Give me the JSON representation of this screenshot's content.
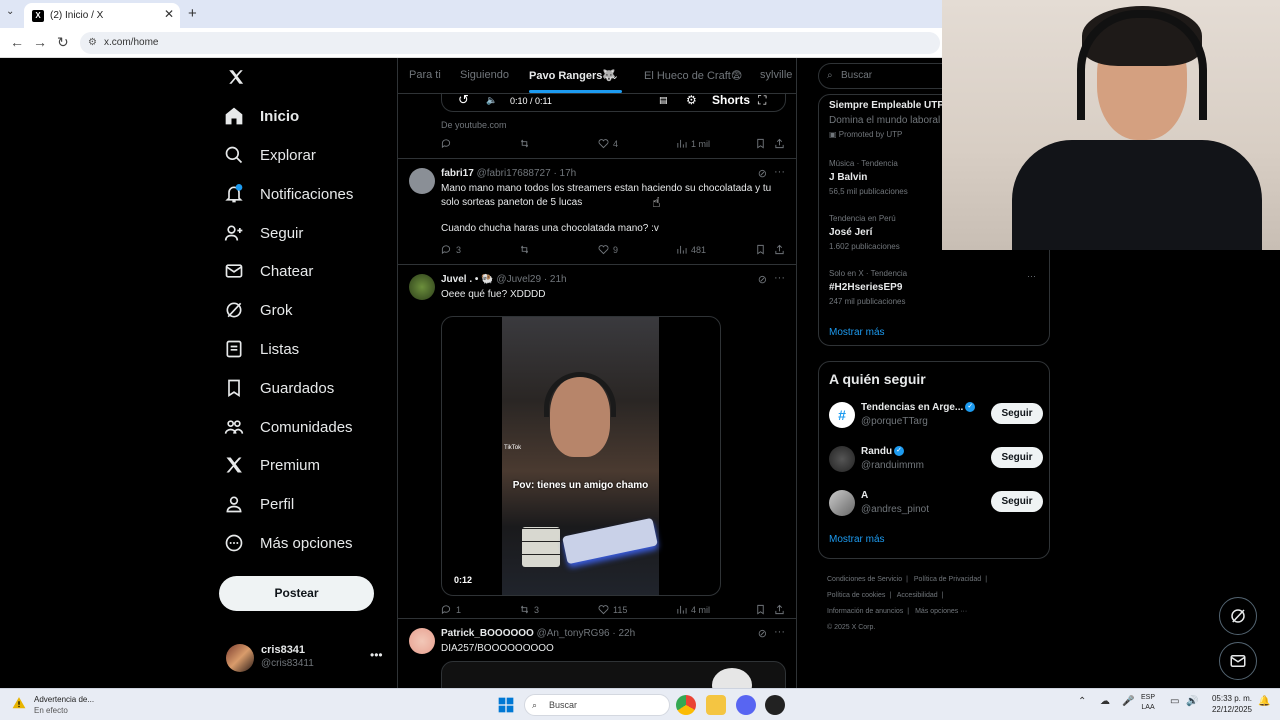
{
  "browser": {
    "tab_title": "(2) Inicio / X",
    "url": "x.com/home"
  },
  "nav": {
    "items": [
      {
        "label": "Inicio",
        "icon": "home-icon"
      },
      {
        "label": "Explorar",
        "icon": "search-icon"
      },
      {
        "label": "Notificaciones",
        "icon": "bell-icon",
        "badge": "2"
      },
      {
        "label": "Seguir",
        "icon": "follow-icon"
      },
      {
        "label": "Chatear",
        "icon": "mail-icon"
      },
      {
        "label": "Grok",
        "icon": "grok-icon"
      },
      {
        "label": "Listas",
        "icon": "list-icon"
      },
      {
        "label": "Guardados",
        "icon": "bookmark-icon"
      },
      {
        "label": "Comunidades",
        "icon": "communities-icon"
      },
      {
        "label": "Premium",
        "icon": "x-logo-icon"
      },
      {
        "label": "Perfil",
        "icon": "profile-icon"
      },
      {
        "label": "Más opciones",
        "icon": "more-icon"
      }
    ],
    "post_label": "Postear",
    "account_name": "cris8341",
    "account_handle": "@cris83411"
  },
  "topbar": {
    "tabs": [
      "Para ti",
      "Siguiendo",
      "Pavo Rangers🐺",
      "El Hueco de Craft😨",
      "sylville"
    ]
  },
  "tweets": {
    "t0": {
      "time": "0:10 / 0:11",
      "shorts": "Shorts",
      "source": "De youtube.com",
      "replies": "",
      "retweets": "",
      "likes": "4",
      "views": "1 mil"
    },
    "t1": {
      "name": "fabri17",
      "handle": "@fabri17688727 · 17h",
      "text1": "Mano mano mano todos los streamers estan haciendo su chocolatada y tu solo sorteas paneton de 5 lucas",
      "text2": "Cuando chucha haras una chocolatada mano? :v",
      "replies": "3",
      "retweets": "",
      "likes": "9",
      "views": "481"
    },
    "t2": {
      "name": "Juvel . • 🐏",
      "handle": "@Juvel29 · 21h",
      "text": "Oeee qué fue? XDDDD",
      "caption": "Pov: tienes un amigo chamo",
      "tiktok": "TikTok",
      "duration": "0:12",
      "replies": "1",
      "retweets": "3",
      "likes": "115",
      "views": "4 mil"
    },
    "t3": {
      "name": "Patrick_BOOOOOO",
      "handle": "@An_tonyRG96 · 22h",
      "text": "DIA257/BOOOOOOOOO"
    }
  },
  "right": {
    "search_placeholder": "Buscar",
    "promo_title": "Siempre Empleable UTP",
    "promo_sub": "Domina el mundo laboral",
    "promo_tag": "Promoted by UTP",
    "trends": [
      {
        "ctx": "Música · Tendencia",
        "name": "J Balvin",
        "count": "56,5 mil publicaciones"
      },
      {
        "ctx": "Tendencia en Perú",
        "name": "José Jerí",
        "count": "1.602 publicaciones"
      },
      {
        "ctx": "Solo en X · Tendencia",
        "name": "#H2HseriesEP9",
        "count": "247 mil publicaciones"
      }
    ],
    "show_more": "Mostrar más",
    "follow_title": "A quién seguir",
    "follow": [
      {
        "name": "Tendencias en Arge...",
        "handle": "@porqueTTarg",
        "btn": "Seguir"
      },
      {
        "name": "Randu",
        "handle": "@randuimmm",
        "btn": "Seguir"
      },
      {
        "name": "A",
        "handle": "@andres_pinot",
        "btn": "Seguir"
      }
    ],
    "footer": [
      "Condiciones de Servicio",
      "|",
      "Política de Privacidad",
      "|",
      "Política de cookies",
      "|",
      "Accesibilidad",
      "|",
      "Información de anuncios",
      "|",
      "Más opciones ···",
      "© 2025 X Corp."
    ]
  },
  "taskbar": {
    "weather_title": "Advertencia de...",
    "weather_sub": "En efecto",
    "search": "Buscar",
    "lang1": "ESP",
    "lang2": "LAA",
    "time": "05:33 p. m.",
    "date": "22/12/2025"
  },
  "colors": {
    "accent": "#1d9bf0",
    "bg": "#000000",
    "border": "#2f3336",
    "muted": "#71767b"
  }
}
